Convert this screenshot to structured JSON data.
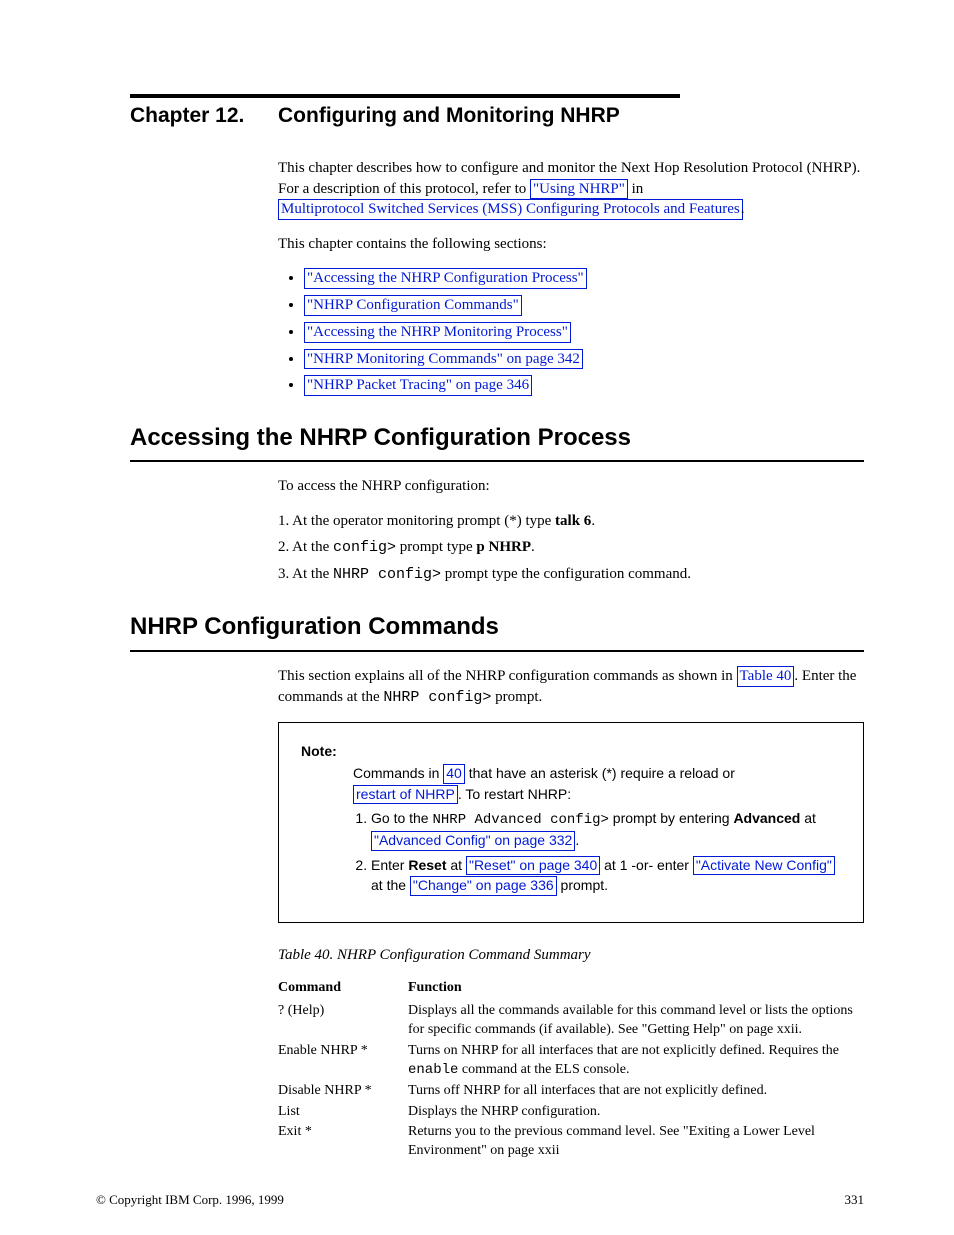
{
  "chapter": {
    "label": "Chapter 12.",
    "title": "Configuring and Monitoring NHRP"
  },
  "intro": {
    "sentence_start": "This chapter describes how to configure and monitor the Next Hop Resolution Protocol (NHRP). For a description of this protocol, refer to ",
    "link_using": "\"Using NHRP\"",
    "sentence_mid": " in ",
    "link_manual": "Multiprotocol Switched Services (MSS) Configuring Protocols and Features",
    "sentence_end": "."
  },
  "sections_label": "This chapter contains the following sections:",
  "sections": [
    "\"Accessing the NHRP Configuration Process\"",
    "\"NHRP Configuration Commands\"",
    "\"Accessing the NHRP Monitoring Process\"",
    "\"NHRP Monitoring Commands\" on page 342",
    "\"NHRP Packet Tracing\" on page 346"
  ],
  "h2_access": "Accessing the NHRP Configuration Process",
  "access_para_1_start": "To access the NHRP configuration:",
  "access_steps": {
    "s1_a": "1. At the operator monitoring prompt (",
    "s1_b": ") type ",
    "s1_c": "talk 6",
    "s1_d": ".",
    "s2_a": "2. At the ",
    "s2_prompt": "config>",
    "s2_b": " prompt type ",
    "s2_c": "p NHRP",
    "s2_d": ".",
    "s3_a": "3. At the ",
    "s3_prompt": "NHRP config>",
    "s3_b": " prompt type the configuration command."
  },
  "h2_cmds": "NHRP Configuration Commands",
  "cmds_para_start": "This section explains all of the NHRP configuration commands as shown in ",
  "link_table": "Table 40",
  "cmds_para_mid": ". Enter the commands at the ",
  "cmds_prompt": "NHRP config>",
  "cmds_para_end": " prompt.",
  "note": {
    "label": "Note:",
    "line1_a": "Commands in ",
    "line1_link": "40",
    "line1_b": " that have an asterisk (*) require a reload or ",
    "line1_link2": "restart of NHRP",
    "line1_end": ". To restart NHRP:",
    "step1_a": "Go to the ",
    "step1_prompt": "NHRP Advanced config>",
    "step1_b": " prompt by entering ",
    "step1_link": "\"Advanced Config\" on page 332",
    "step1_end": ".",
    "step2_a": "Enter ",
    "step2_link": "\"Reset\" on page 340",
    "step2_b": " at 1 -or- enter ",
    "step2_link2": "\"Activate New Config\"",
    "step2_end": " at the ",
    "step2_link3": "\"Change\" on page 336",
    "step2_end2": " prompt."
  },
  "table_ref": "Table 40. NHRP Configuration Command Summary",
  "table": {
    "head_cmd": "Command",
    "head_func": "Function",
    "row1_cmd": "? (Help)",
    "row1_func": "Displays all the commands available for this command level or lists the options for specific commands (if available). See ",
    "row1_link": "\"Getting Help\" on page xxii",
    "row1_end": ".",
    "row2_cmd_a": "Enable NHRP *",
    "row2_func_a": "Turns on NHRP for all interfaces that are not explicitly defined. Requires the ",
    "row2_mono": "enable",
    "row2_func_b": " command at the ELS console.",
    "row3_cmd": "Disable NHRP *",
    "row3_func": "Turns off NHRP for all interfaces that are not explicitly defined.",
    "row4_cmd": "List",
    "row4_func": "Displays the NHRP configuration.",
    "row5_cmd": "Exit *",
    "row5_func": "Returns you to the previous command level. See ",
    "row5_link": "\"Exiting a Lower Level Environment\" on page xxii"
  },
  "footer": {
    "left": "© Copyright IBM Corp. 1996, 1999",
    "right": "331"
  }
}
